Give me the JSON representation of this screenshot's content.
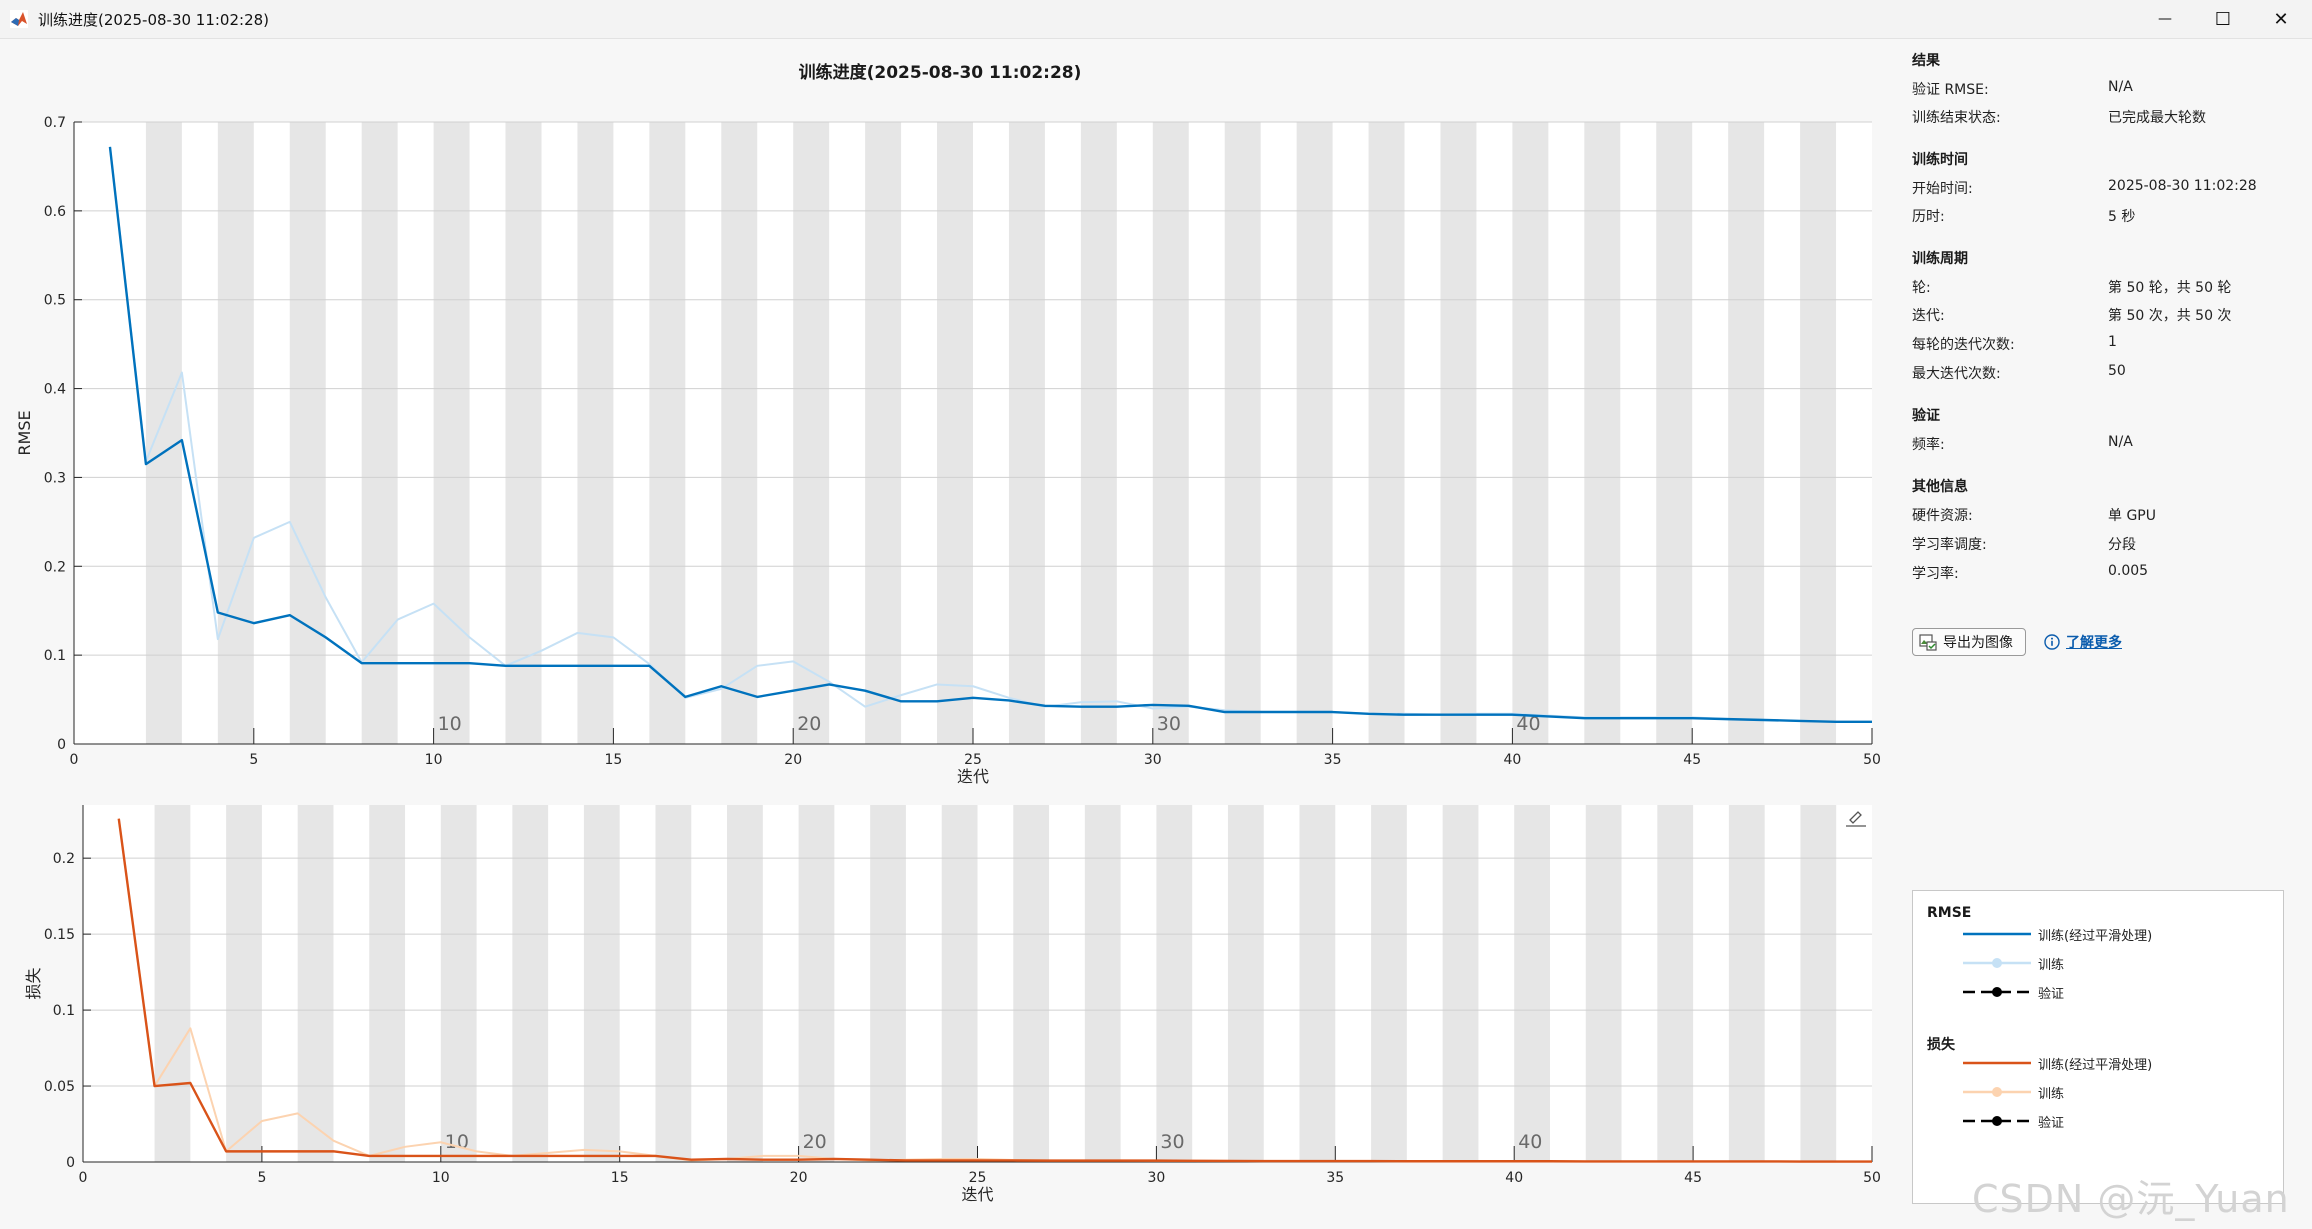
{
  "window": {
    "title": "训练进度(2025-08-30 11:02:28)",
    "minimize": "—",
    "maximize": "☐",
    "close": "✕"
  },
  "figure": {
    "title": "训练进度(2025-08-30 11:02:28)"
  },
  "info": {
    "results": {
      "title": "结果",
      "rows": [
        {
          "label": "验证 RMSE:",
          "value": "N/A"
        },
        {
          "label": "训练结束状态:",
          "value": "已完成最大轮数"
        }
      ]
    },
    "time": {
      "title": "训练时间",
      "rows": [
        {
          "label": "开始时间:",
          "value": "2025-08-30 11:02:28"
        },
        {
          "label": "历时:",
          "value": "5 秒"
        }
      ]
    },
    "cycle": {
      "title": "训练周期",
      "rows": [
        {
          "label": "轮:",
          "value": "第 50 轮，共 50 轮"
        },
        {
          "label": "迭代:",
          "value": "第 50 次，共 50 次"
        },
        {
          "label": "每轮的迭代次数:",
          "value": "1"
        },
        {
          "label": "最大迭代次数:",
          "value": "50"
        }
      ]
    },
    "validation": {
      "title": "验证",
      "rows": [
        {
          "label": "频率:",
          "value": "N/A"
        }
      ]
    },
    "other": {
      "title": "其他信息",
      "rows": [
        {
          "label": "硬件资源:",
          "value": "单 GPU"
        },
        {
          "label": "学习率调度:",
          "value": "分段"
        },
        {
          "label": "学习率:",
          "value": "0.005"
        }
      ]
    }
  },
  "buttons": {
    "export": "导出为图像",
    "learn_more": "了解更多"
  },
  "legend": {
    "rmse_title": "RMSE",
    "rmse_items": [
      "训练(经过平滑处理)",
      "训练",
      "验证"
    ],
    "loss_title": "损失",
    "loss_items": [
      "训练(经过平滑处理)",
      "训练",
      "验证"
    ]
  },
  "watermark": "CSDN @沅_Yuan",
  "colors": {
    "rmse_smoothed": "#0072bd",
    "rmse_raw": "#c6e1f5",
    "loss_smoothed": "#d95319",
    "loss_raw": "#fcd3b0",
    "epoch_band": "#e6e6e6",
    "validation": "#000000"
  },
  "chart_data": [
    {
      "type": "line",
      "xlabel": "迭代",
      "ylabel": "RMSE",
      "xlim": [
        0,
        50
      ],
      "ylim": [
        0,
        0.7
      ],
      "xticks": [
        0,
        5,
        10,
        15,
        20,
        25,
        30,
        35,
        40,
        45,
        50
      ],
      "yticks": [
        0,
        0.1,
        0.2,
        0.3,
        0.4,
        0.5,
        0.6,
        0.7
      ],
      "epoch_labels": [
        10,
        20,
        30,
        40
      ],
      "x": [
        1,
        2,
        3,
        4,
        5,
        6,
        7,
        8,
        9,
        10,
        11,
        12,
        13,
        14,
        15,
        16,
        17,
        18,
        19,
        20,
        21,
        22,
        23,
        24,
        25,
        26,
        27,
        28,
        29,
        30,
        31,
        32,
        33,
        34,
        35,
        36,
        37,
        38,
        39,
        40,
        41,
        42,
        43,
        44,
        45,
        46,
        47,
        48,
        49,
        50
      ],
      "series": [
        {
          "name": "训练",
          "values": [
            0.672,
            0.318,
            0.418,
            0.118,
            0.232,
            0.25,
            0.165,
            0.092,
            0.14,
            0.158,
            0.12,
            0.088,
            0.105,
            0.125,
            0.12,
            0.09,
            0.052,
            0.062,
            0.088,
            0.093,
            0.07,
            0.042,
            0.055,
            0.067,
            0.065,
            0.052,
            0.042,
            0.047,
            0.048,
            0.04,
            0.042,
            0.038,
            0.036,
            0.036,
            0.036,
            0.034,
            0.034,
            0.033,
            0.034,
            0.034,
            0.032,
            0.03,
            0.03,
            0.03,
            0.03,
            0.028,
            0.027,
            0.026,
            0.025,
            0.025
          ]
        },
        {
          "name": "训练(经过平滑处理)",
          "values": [
            0.672,
            0.315,
            0.342,
            0.148,
            0.136,
            0.145,
            0.12,
            0.091,
            0.091,
            0.091,
            0.091,
            0.088,
            0.088,
            0.088,
            0.088,
            0.088,
            0.053,
            0.065,
            0.053,
            0.06,
            0.067,
            0.06,
            0.048,
            0.048,
            0.052,
            0.049,
            0.043,
            0.042,
            0.042,
            0.044,
            0.043,
            0.036,
            0.036,
            0.036,
            0.036,
            0.034,
            0.033,
            0.033,
            0.033,
            0.033,
            0.031,
            0.029,
            0.029,
            0.029,
            0.029,
            0.028,
            0.027,
            0.026,
            0.025,
            0.025
          ]
        }
      ]
    },
    {
      "type": "line",
      "xlabel": "迭代",
      "ylabel": "损失",
      "xlim": [
        0,
        50
      ],
      "ylim": [
        0,
        0.235
      ],
      "xticks": [
        0,
        5,
        10,
        15,
        20,
        25,
        30,
        35,
        40,
        45,
        50
      ],
      "yticks": [
        0,
        0.05,
        0.1,
        0.15,
        0.2
      ],
      "epoch_labels": [
        10,
        20,
        30,
        40
      ],
      "x": [
        1,
        2,
        3,
        4,
        5,
        6,
        7,
        8,
        9,
        10,
        11,
        12,
        13,
        14,
        15,
        16,
        17,
        18,
        19,
        20,
        21,
        22,
        23,
        24,
        25,
        26,
        27,
        28,
        29,
        30,
        31,
        32,
        33,
        34,
        35,
        36,
        37,
        38,
        39,
        40,
        41,
        42,
        43,
        44,
        45,
        46,
        47,
        48,
        49,
        50
      ],
      "series": [
        {
          "name": "训练",
          "values": [
            0.226,
            0.05,
            0.088,
            0.007,
            0.027,
            0.032,
            0.014,
            0.004,
            0.01,
            0.013,
            0.007,
            0.004,
            0.006,
            0.008,
            0.007,
            0.004,
            0.001,
            0.002,
            0.004,
            0.004,
            0.002,
            0.001,
            0.0015,
            0.002,
            0.002,
            0.0013,
            0.001,
            0.001,
            0.001,
            0.0008,
            0.0008,
            0.0007,
            0.0006,
            0.0006,
            0.0006,
            0.0006,
            0.0005,
            0.0005,
            0.0005,
            0.0005,
            0.0005,
            0.0004,
            0.0004,
            0.0004,
            0.0004,
            0.0004,
            0.0004,
            0.0003,
            0.0003,
            0.0003
          ]
        },
        {
          "name": "训练(经过平滑处理)",
          "values": [
            0.226,
            0.05,
            0.052,
            0.007,
            0.007,
            0.007,
            0.007,
            0.004,
            0.004,
            0.004,
            0.004,
            0.004,
            0.004,
            0.004,
            0.004,
            0.004,
            0.0015,
            0.002,
            0.0015,
            0.0015,
            0.002,
            0.0015,
            0.001,
            0.001,
            0.001,
            0.001,
            0.0009,
            0.0009,
            0.0009,
            0.0009,
            0.0008,
            0.0007,
            0.0006,
            0.0006,
            0.0006,
            0.0006,
            0.0005,
            0.0005,
            0.0005,
            0.0005,
            0.0005,
            0.0004,
            0.0004,
            0.0004,
            0.0004,
            0.0004,
            0.0004,
            0.0003,
            0.0003,
            0.0003
          ]
        }
      ]
    }
  ]
}
